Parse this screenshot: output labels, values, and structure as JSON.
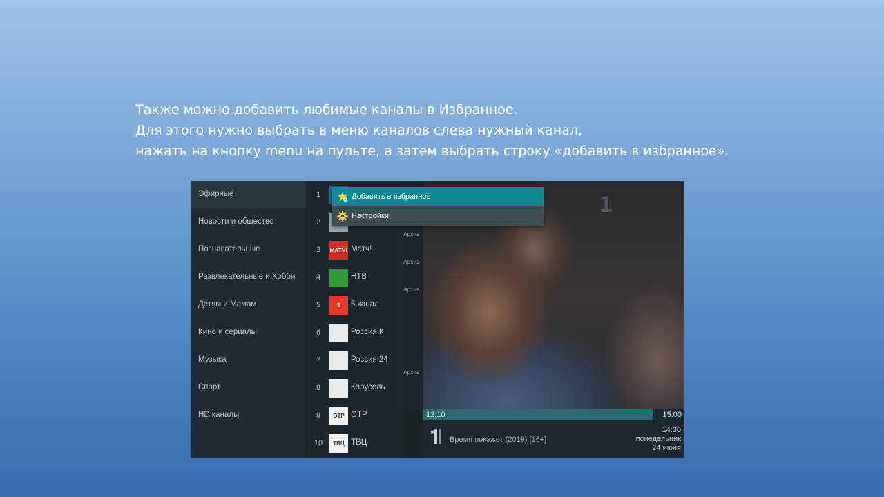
{
  "instructions": [
    "Также можно добавить любимые каналы в Избранное.",
    "Для этого нужно выбрать в меню каналов слева нужный канал,",
    "нажать на кнопку menu на пульте, а затем выбрать строку «добавить в избранное»."
  ],
  "categories": [
    {
      "label": "Эфирные",
      "active": true
    },
    {
      "label": "Новости и общество"
    },
    {
      "label": "Познавательные"
    },
    {
      "label": "Развлекательные и Хобби"
    },
    {
      "label": "Детям и Мамам"
    },
    {
      "label": "Кино и сериалы"
    },
    {
      "label": "Музыка"
    },
    {
      "label": "Спорт"
    },
    {
      "label": "HD каналы"
    }
  ],
  "channels": [
    {
      "num": "1",
      "name": "",
      "logo": "perviy-logo",
      "logo_color": "#2b5f9e"
    },
    {
      "num": "2",
      "name": "",
      "logo": "russia1-logo",
      "logo_color": "#9aa6b0"
    },
    {
      "num": "3",
      "name": "Матч!",
      "logo": "match-logo",
      "logo_text": "МАТЧ!",
      "logo_color": "#d52b1e"
    },
    {
      "num": "4",
      "name": "НТВ",
      "logo": "ntv-logo",
      "logo_color": "#2e9a3c"
    },
    {
      "num": "5",
      "name": "5 канал",
      "logo": "channel5-logo",
      "logo_text": "5",
      "logo_color": "#e53a2a"
    },
    {
      "num": "6",
      "name": "Россия К",
      "logo": "russiak-logo",
      "logo_color": "#e8ecef"
    },
    {
      "num": "7",
      "name": "Россия 24",
      "logo": "russia24-logo",
      "logo_color": "#e8ecef"
    },
    {
      "num": "8",
      "name": "Карусель",
      "logo": "karusel-logo",
      "logo_color": "#e8ecef"
    },
    {
      "num": "9",
      "name": "ОТР",
      "logo": "otr-logo",
      "logo_text": "ОТР",
      "logo_color": "#f2f2f2"
    },
    {
      "num": "10",
      "name": "ТВЦ",
      "logo": "tvc-logo",
      "logo_text": "ТВЦ",
      "logo_color": "#f2f2f2"
    }
  ],
  "archive_label": "Архив",
  "archive_rows": [
    3,
    4,
    5,
    8
  ],
  "context_menu": {
    "items": [
      {
        "label": "Добавить в избранное",
        "icon": "star-icon",
        "selected": true
      },
      {
        "label": "Настройки",
        "icon": "gear-icon",
        "selected": false
      }
    ]
  },
  "playback": {
    "start_time": "12:10",
    "end_time": "15:00",
    "progress": 0.88
  },
  "program": {
    "title": "Время покажет (2019) [16+]",
    "time": "14:30",
    "weekday": "понедельник",
    "date": "24 июня"
  },
  "colors": {
    "accent": "#0f8b93",
    "panel": "#222c32",
    "slide_bg_top": "#9ec4e8",
    "slide_bg_bottom": "#3a6db0"
  }
}
